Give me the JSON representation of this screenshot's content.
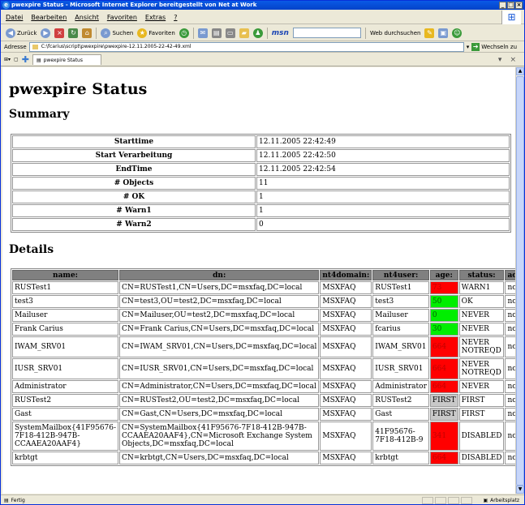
{
  "window": {
    "title": "pwexpire Status - Microsoft Internet Explorer bereitgestellt von Net at Work"
  },
  "menu": [
    "Datei",
    "Bearbeiten",
    "Ansicht",
    "Favoriten",
    "Extras",
    "?"
  ],
  "toolbar": {
    "back": "Zurück",
    "search": "Suchen",
    "favorites": "Favoriten",
    "msn": "msn",
    "web_search": "Web durchsuchen"
  },
  "address": {
    "label": "Adresse",
    "url": "C:\\fcarius\\script\\pwexpire\\pwexpire-12.11.2005-22-42-49.xml",
    "go": "Wechseln zu"
  },
  "tab": {
    "label": "pwexpire Status"
  },
  "page": {
    "h1": "pwexpire Status",
    "summary_heading": "Summary",
    "details_heading": "Details"
  },
  "summary": [
    {
      "k": "Starttime",
      "v": "12.11.2005 22:42:49"
    },
    {
      "k": "Start Verarbeitung",
      "v": "12.11.2005 22:42:50"
    },
    {
      "k": "EndTime",
      "v": "12.11.2005 22:42:54"
    },
    {
      "k": "# Objects",
      "v": "11"
    },
    {
      "k": "# OK",
      "v": "1"
    },
    {
      "k": "# Warn1",
      "v": "1"
    },
    {
      "k": "# Warn2",
      "v": "0"
    }
  ],
  "details": {
    "headers": [
      "name:",
      "dn:",
      "nt4domain:",
      "nt4user:",
      "age:",
      "status:",
      "action:"
    ],
    "rows": [
      {
        "name": "RUSTest1",
        "dn": "CN=RUSTest1,CN=Users,DC=msxfaq,DC=local",
        "domain": "MSXFAQ",
        "user": "RUSTest1",
        "age": "73",
        "age_class": "red",
        "status": "WARN1",
        "action": "noMail"
      },
      {
        "name": "test3",
        "dn": "CN=test3,OU=test2,DC=msxfaq,DC=local",
        "domain": "MSXFAQ",
        "user": "test3",
        "age": "50",
        "age_class": "green",
        "status": "OK",
        "action": "none"
      },
      {
        "name": "Mailuser",
        "dn": "CN=Mailuser,OU=test2,DC=msxfaq,DC=local",
        "domain": "MSXFAQ",
        "user": "Mailuser",
        "age": "0",
        "age_class": "green",
        "status": "NEVER",
        "action": "none"
      },
      {
        "name": "Frank Carius",
        "dn": "CN=Frank Carius,CN=Users,DC=msxfaq,DC=local",
        "domain": "MSXFAQ",
        "user": "fcarius",
        "age": "30",
        "age_class": "green",
        "status": "NEVER",
        "action": "none"
      },
      {
        "name": "IWAM_SRV01",
        "dn": "CN=IWAM_SRV01,CN=Users,DC=msxfaq,DC=local",
        "domain": "MSXFAQ",
        "user": "IWAM_SRV01",
        "age": "664",
        "age_class": "red",
        "status": "NEVER NOTREQD",
        "action": "none"
      },
      {
        "name": "IUSR_SRV01",
        "dn": "CN=IUSR_SRV01,CN=Users,DC=msxfaq,DC=local",
        "domain": "MSXFAQ",
        "user": "IUSR_SRV01",
        "age": "664",
        "age_class": "red",
        "status": "NEVER NOTREQD",
        "action": "none"
      },
      {
        "name": "Administrator",
        "dn": "CN=Administrator,CN=Users,DC=msxfaq,DC=local",
        "domain": "MSXFAQ",
        "user": "Administrator",
        "age": "664",
        "age_class": "red",
        "status": "NEVER",
        "action": "none"
      },
      {
        "name": "RUSTest2",
        "dn": "CN=RUSTest2,OU=test2,DC=msxfaq,DC=local",
        "domain": "MSXFAQ",
        "user": "RUSTest2",
        "age": "FIRST",
        "age_class": "grey",
        "status": "FIRST",
        "action": "none"
      },
      {
        "name": "Gast",
        "dn": "CN=Gast,CN=Users,DC=msxfaq,DC=local",
        "domain": "MSXFAQ",
        "user": "Gast",
        "age": "FIRST",
        "age_class": "grey",
        "status": "FIRST",
        "action": "none"
      },
      {
        "name": "SystemMailbox{41F95676-7F18-412B-947B-CCAAEA20AAF4}",
        "dn": "CN=SystemMailbox{41F95676-7F18-412B-947B-CCAAEA20AAF4},CN=Microsoft Exchange System Objects,DC=msxfaq,DC=local",
        "domain": "MSXFAQ",
        "user": "41F95676-7F18-412B-9",
        "age": "341",
        "age_class": "red",
        "status": "DISABLED",
        "action": "none"
      },
      {
        "name": "krbtgt",
        "dn": "CN=krbtgt,CN=Users,DC=msxfaq,DC=local",
        "domain": "MSXFAQ",
        "user": "krbtgt",
        "age": "664",
        "age_class": "red",
        "status": "DISABLED",
        "action": "none"
      }
    ]
  },
  "statusbar": {
    "left": "Fertig",
    "zone": "Arbeitsplatz"
  },
  "colors": {
    "red": "#ff0000",
    "green": "#00ee00",
    "grey": "#c8c8c8",
    "header": "#808080"
  }
}
